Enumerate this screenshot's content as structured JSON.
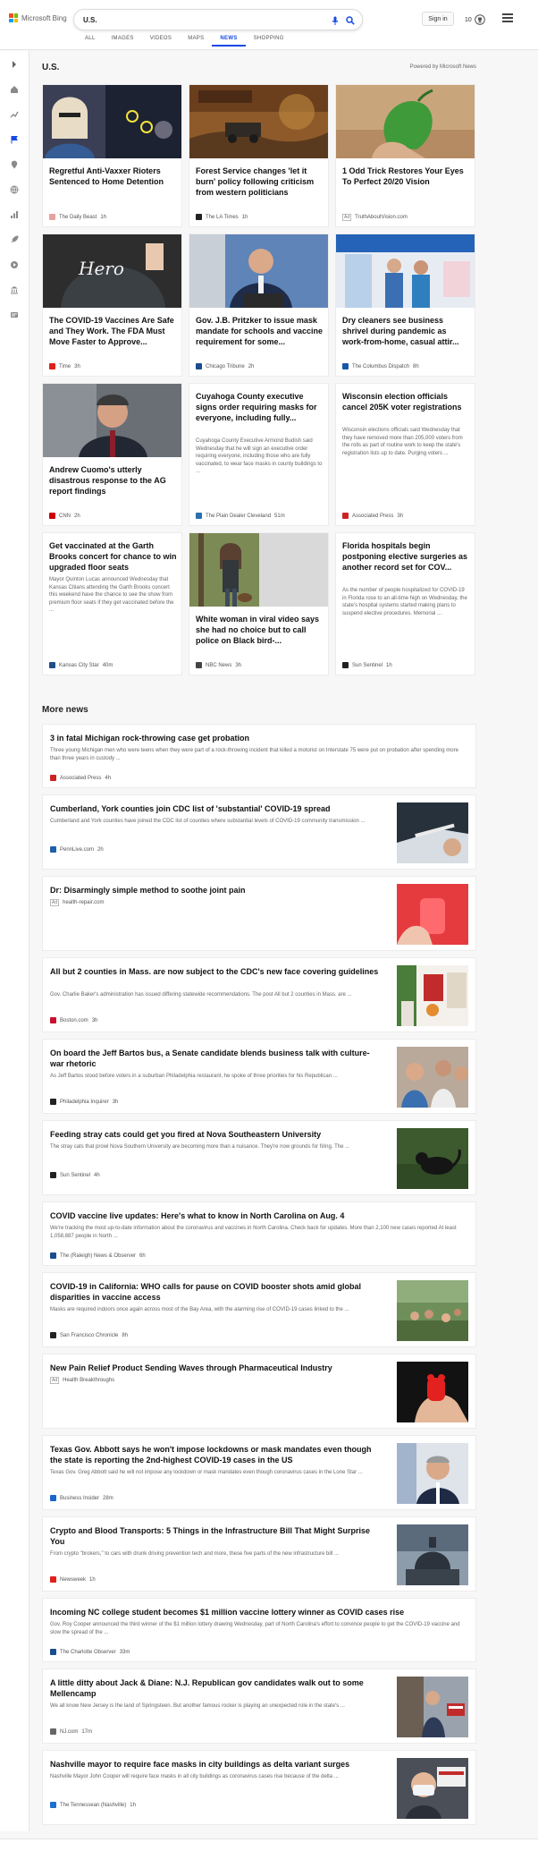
{
  "header": {
    "brand": "Microsoft Bing",
    "search_value": "U.S.",
    "tabs": [
      "ALL",
      "IMAGES",
      "VIDEOS",
      "MAPS",
      "NEWS",
      "SHOPPING"
    ],
    "active_tab": "NEWS",
    "signin_label": "Sign in",
    "rewards_count": "10",
    "brand_colors": [
      "#f25022",
      "#7fba00",
      "#00a4ef",
      "#ffb900"
    ],
    "accent": "#174ae4"
  },
  "section": {
    "title": "U.S.",
    "powered_by": "Powered by Microsoft News"
  },
  "cards": [
    {
      "title": "Regretful Anti-Vaxxer Rioters Sentenced to Home Detention",
      "desc": "",
      "source": "The Daily Beast",
      "time": "1h",
      "ad": false,
      "logo_color": "#e8a0a0",
      "image": "photo-woman-glasses-riot"
    },
    {
      "title": "Forest Service changes 'let it burn' policy following criticism from western politicians",
      "desc": "",
      "source": "The LA Times",
      "time": "1h",
      "ad": false,
      "logo_color": "#222222",
      "image": "photo-wildfire-smoke"
    },
    {
      "title": "1 Odd Trick Restores Your Eyes To Perfect 20/20 Vision",
      "desc": "",
      "source": "TruthAboutVision.com",
      "time": "",
      "ad": true,
      "logo_color": "",
      "image": "photo-green-pepper-hand"
    },
    {
      "title": "The COVID-19 Vaccines Are Safe and They Work. The FDA Must Move Faster to Approve...",
      "desc": "",
      "source": "Time",
      "time": "3h",
      "ad": false,
      "logo_color": "#e0201b",
      "image": "photo-hero-shirt"
    },
    {
      "title": "Gov. J.B. Pritzker to issue mask mandate for schools and vaccine requirement for some...",
      "desc": "",
      "source": "Chicago Tribune",
      "time": "2h",
      "ad": false,
      "logo_color": "#1a4d8f",
      "image": "photo-pritzker-podium"
    },
    {
      "title": "Dry cleaners see business shrivel during pandemic as work-from-home, casual attir...",
      "desc": "",
      "source": "The Columbus Dispatch",
      "time": "8h",
      "ad": false,
      "logo_color": "#1a56a8",
      "image": "photo-dry-cleaners"
    },
    {
      "title": "Andrew Cuomo's utterly disastrous response to the AG report findings",
      "desc": "",
      "source": "CNN",
      "time": "2h",
      "ad": false,
      "logo_color": "#cc0000",
      "image": "photo-cuomo"
    },
    {
      "title": "Cuyahoga County executive signs order requiring masks for everyone, including fully...",
      "desc": "Cuyahoga County Executive Armond Budish said Wednesday that he will sign an executive order requiring everyone, including those who are fully vaccinated, to wear face masks in county buildings to ...",
      "source": "The Plain Dealer Cleveland",
      "time": "51m",
      "ad": false,
      "logo_color": "#2a6fb0",
      "image": ""
    },
    {
      "title": "Wisconsin election officials cancel 205K voter registrations",
      "desc": "Wisconsin elections officials said Wednesday that they have removed more than 205,000 voters from the rolls as part of routine work to keep the state's registration lists up to date. Purging voters ...",
      "source": "Associated Press",
      "time": "3h",
      "ad": false,
      "logo_color": "#cc2222",
      "image": ""
    },
    {
      "title": "Get vaccinated at the Garth Brooks concert for chance to win upgraded floor seats",
      "desc": "Mayor Quinton Lucas announced Wednesday that Kansas Citians attending the Garth Brooks concert this weekend have the chance to see the show from premium floor seats if they get vaccinated before the ...",
      "source": "Kansas City Star",
      "time": "40m",
      "ad": false,
      "logo_color": "#1f4e8c",
      "image": ""
    },
    {
      "title": "White woman in viral video says she had no choice but to call police on Black bird-...",
      "desc": "",
      "source": "NBC News",
      "time": "3h",
      "ad": false,
      "logo_color": "#444444",
      "image": "photo-woman-park-dog"
    },
    {
      "title": "Florida hospitals begin postponing elective surgeries as another record set for COV...",
      "desc": "As the number of people hospitalized for COVID-19 in Florida rose to an all-time high on Wednesday, the state's hospital systems started making plans to suspend elective procedures. Memorial ...",
      "source": "Sun Sentinel",
      "time": "1h",
      "ad": false,
      "logo_color": "#222222",
      "image": ""
    }
  ],
  "more_news": {
    "title": "More news",
    "items": [
      {
        "title": "3 in fatal Michigan rock-throwing case get probation",
        "desc": "Three young Michigan men who were teens when they were part of a rock-throwing incident that killed a motorist on Interstate 75 were put on probation after spending more than three years in custody ...",
        "source": "Associated Press",
        "time": "4h",
        "ad": false,
        "logo_color": "#cc2222",
        "image": ""
      },
      {
        "title": "Cumberland, York counties join CDC list of 'substantial' COVID-19 spread",
        "desc": "Cumberland and York counties have joined the CDC list of counties where substantial levels of COVID-19 community transmission ...",
        "source": "PennLive.com",
        "time": "2h",
        "ad": false,
        "logo_color": "#1d5fa8",
        "image": "photo-vaccine-syringe"
      },
      {
        "title": "Dr: Disarmingly simple method to soothe joint pain",
        "desc": "",
        "source": "health-repair.com",
        "time": "",
        "ad": true,
        "logo_color": "",
        "image": "photo-red-gummy"
      },
      {
        "title": "All but 2 counties in Mass. are now subject to the CDC's new face covering guidelines",
        "desc": "Gov. Charlie Baker's administration has issued differing statewide recommendations. The post All but 2 counties in Mass. are ...",
        "source": "Boston.com",
        "time": "3h",
        "ad": false,
        "logo_color": "#c8102e",
        "image": "photo-storefront"
      },
      {
        "title": "On board the Jeff Bartos bus, a Senate candidate blends business talk with culture-war rhetoric",
        "desc": "As Jeff Bartos stood before voters in a suburban Philadelphia restaurant, he spoke of three priorities for his Republican ...",
        "source": "Philadelphia Inquirer",
        "time": "3h",
        "ad": false,
        "logo_color": "#222222",
        "image": "photo-crowd-restaurant"
      },
      {
        "title": "Feeding stray cats could get you fired at Nova Southeastern University",
        "desc": "The stray cats that prowl Nova Southern University are becoming more than a nuisance. They're now grounds for firing. The ...",
        "source": "Sun Sentinel",
        "time": "4h",
        "ad": false,
        "logo_color": "#222222",
        "image": "photo-black-cat-grass"
      },
      {
        "title": "COVID vaccine live updates: Here's what to know in North Carolina on Aug. 4",
        "desc": "We're tracking the most up-to-date information about the coronavirus and vaccines in North Carolina. Check back for updates. More than 2,100 new cases reported At least 1,058,887 people in North ...",
        "source": "The (Raleigh) News & Observer",
        "time": "6h",
        "ad": false,
        "logo_color": "#1a4d8f",
        "image": ""
      },
      {
        "title": "COVID-19 in California: WHO calls for pause on COVID booster shots amid global disparities in vaccine access",
        "desc": "Masks are required indoors once again across most of the Bay Area, with the alarming rise of COVID-19 cases linked to the ...",
        "source": "San Francisco Chronicle",
        "time": "8h",
        "ad": false,
        "logo_color": "#222222",
        "image": "photo-outdoor-gathering"
      },
      {
        "title": "New Pain Relief Product Sending Waves through Pharmaceutical Industry",
        "desc": "",
        "source": "Health Breakthroughs",
        "time": "",
        "ad": true,
        "logo_color": "",
        "image": "photo-gummy-bear-hand"
      },
      {
        "title": "Texas Gov. Abbott says he won't impose lockdowns or mask mandates even though the state is reporting the 2nd-highest COVID-19 cases in the US",
        "desc": "Texas Gov. Greg Abbott said he will not impose any lockdown or mask mandates even though coronavirus cases in the Lone Star ...",
        "source": "Business Insider",
        "time": "28m",
        "ad": false,
        "logo_color": "#1a66cc",
        "image": "photo-abbott"
      },
      {
        "title": "Crypto and Blood Transports: 5 Things in the Infrastructure Bill That Might Surprise You",
        "desc": "From crypto \"brokers,\" to cars with drunk driving prevention tech and more, these five parts of the new infrastructure bill ...",
        "source": "Newsweek",
        "time": "1h",
        "ad": false,
        "logo_color": "#e0201b",
        "image": "photo-capitol-dome"
      },
      {
        "title": "Incoming NC college student becomes $1 million vaccine lottery winner as COVID cases rise",
        "desc": "Gov. Roy Cooper announced the third winner of the $1 million lottery drawing Wednesday, part of North Carolina's effort to convince people to get the COVID-19 vaccine and slow the spread of the ...",
        "source": "The Charlotte Observer",
        "time": "33m",
        "ad": false,
        "logo_color": "#1a4d8f",
        "image": ""
      },
      {
        "title": "A little ditty about Jack & Diane: N.J. Republican gov candidates walk out to some Mellencamp",
        "desc": "We all know New Jersey is the land of Springsteen. But another famous rocker is playing an unexpected role in the state's ...",
        "source": "NJ.com",
        "time": "17m",
        "ad": false,
        "logo_color": "#666666",
        "image": "photo-campaign-rally"
      },
      {
        "title": "Nashville mayor to require face masks in city buildings as delta variant surges",
        "desc": "Nashville Mayor John Cooper will require face masks in all city buildings as coronavirus cases rise because of the delta ...",
        "source": "The Tennessean (Nashville)",
        "time": "1h",
        "ad": false,
        "logo_color": "#1d6fd0",
        "image": "photo-mask-protester"
      }
    ]
  }
}
